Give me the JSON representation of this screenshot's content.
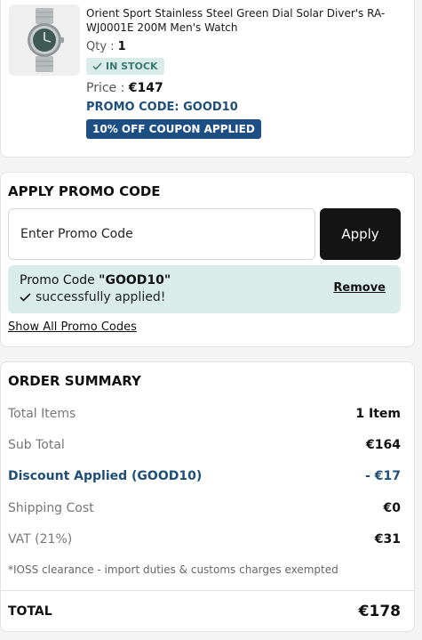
{
  "product": {
    "title": "Orient Sport Stainless Steel Green Dial Solar Diver's RA-WJ0001E 200M Men's Watch",
    "qty_label": "Qty : ",
    "qty_value": "1",
    "stock": "IN STOCK",
    "price_label": "Price : ",
    "price_value": "€147",
    "promo_label": "PROMO CODE: ",
    "promo_code": "GOOD10",
    "coupon_badge": "10% OFF COUPON APPLIED"
  },
  "promo": {
    "title": "APPLY PROMO CODE",
    "input_placeholder": "Enter Promo Code",
    "apply_label": "Apply",
    "applied_prefix": "Promo Code ",
    "applied_code": "\"GOOD10\"",
    "applied_text": "successfully applied!",
    "remove_label": "Remove",
    "show_all_label": "Show All Promo Codes"
  },
  "summary": {
    "title": "ORDER SUMMARY",
    "rows": [
      {
        "label": "Total Items",
        "value": "1 Item"
      },
      {
        "label": "Sub Total",
        "value": "€164"
      },
      {
        "label": "Discount Applied (GOOD10)",
        "value": "- €17"
      },
      {
        "label": "Shipping Cost",
        "value": "€0"
      },
      {
        "label": "VAT (21%)",
        "value": "€31"
      }
    ],
    "note": "*IOSS clearance - import duties & customs charges exempted",
    "total_label": "TOTAL",
    "total_value": "€178"
  },
  "colors": {
    "accent_blue": "#1d4f84",
    "applied_bg": "#d9ecea",
    "button_dark": "#141414"
  },
  "icons": [
    "watch-image",
    "check-icon"
  ]
}
